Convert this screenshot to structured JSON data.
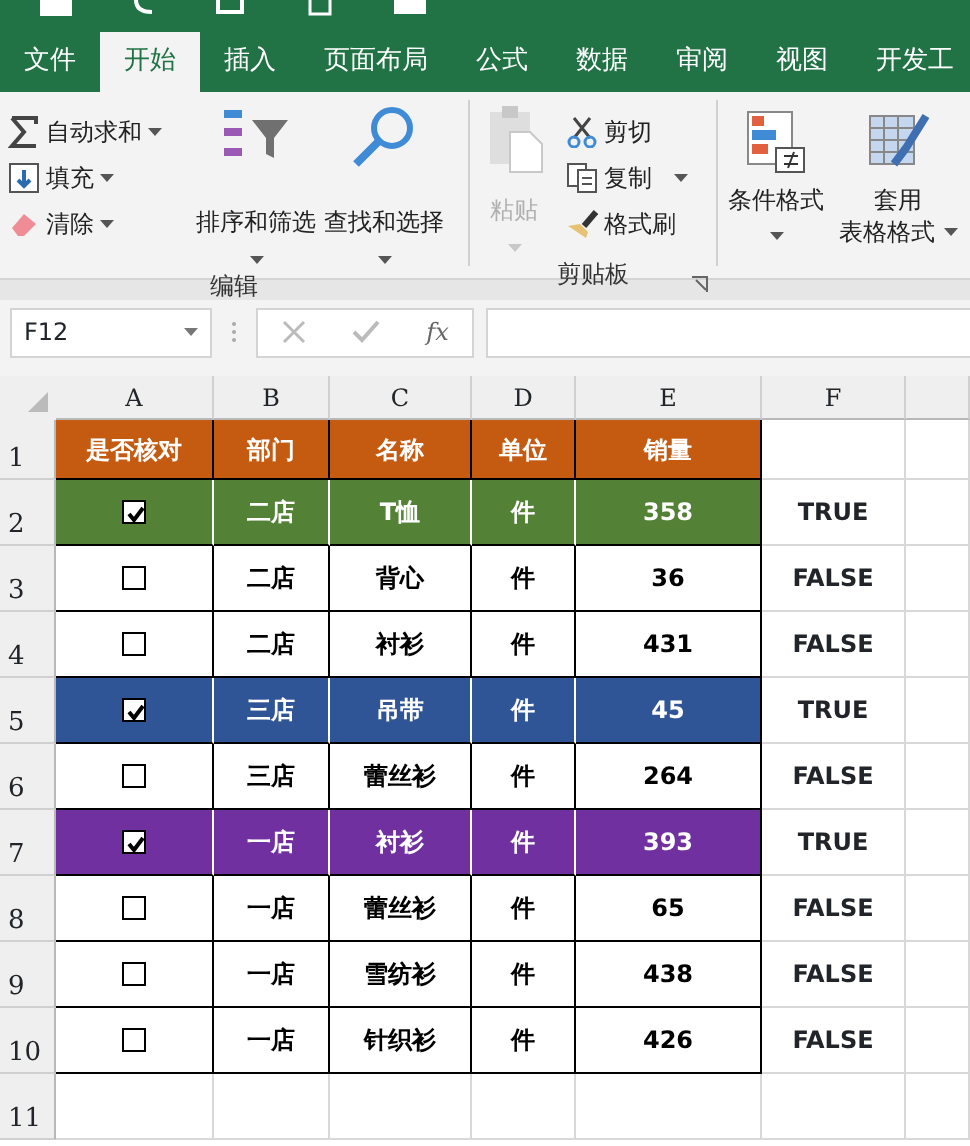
{
  "tabs": [
    {
      "label": "文件",
      "selected": false
    },
    {
      "label": "开始",
      "selected": true
    },
    {
      "label": "插入",
      "selected": false
    },
    {
      "label": "页面布局",
      "selected": false
    },
    {
      "label": "公式",
      "selected": false
    },
    {
      "label": "数据",
      "selected": false
    },
    {
      "label": "审阅",
      "selected": false
    },
    {
      "label": "视图",
      "selected": false
    },
    {
      "label": "开发工",
      "selected": false
    }
  ],
  "ribbon": {
    "editing": {
      "label": "编辑",
      "small_items": [
        {
          "label": "自动求和",
          "dropdown": true
        },
        {
          "label": "填充",
          "dropdown": true
        },
        {
          "label": "清除",
          "dropdown": true
        }
      ],
      "large_items": [
        {
          "label": "排序和筛选",
          "dropdown": true
        },
        {
          "label": "查找和选择",
          "dropdown": true
        }
      ]
    },
    "clipboard": {
      "label": "剪贴板",
      "paste": {
        "label": "粘贴",
        "disabled": true,
        "dropdown": true
      },
      "small_items": [
        {
          "label": "剪切",
          "dropdown": false
        },
        {
          "label": "复制",
          "dropdown": true
        },
        {
          "label": "格式刷",
          "dropdown": false
        }
      ]
    },
    "styles": {
      "items": [
        {
          "lines": [
            "条件格式"
          ],
          "dropdown": true
        },
        {
          "lines": [
            "套用",
            "表格格式"
          ],
          "dropdown": true
        }
      ]
    }
  },
  "formula_bar": {
    "name_box": "F12",
    "function_label": "fx"
  },
  "sheet": {
    "columns": [
      "A",
      "B",
      "C",
      "D",
      "E",
      "F"
    ],
    "row_numbers": [
      "1",
      "2",
      "3",
      "4",
      "5",
      "6",
      "7",
      "8",
      "9",
      "10",
      "11"
    ],
    "header": {
      "color": "#c55a11",
      "cells": [
        "是否核对",
        "部门",
        "名称",
        "单位",
        "销量"
      ]
    },
    "rows": [
      {
        "checked": true,
        "color": "#538135",
        "cells": [
          "",
          "二店",
          "T恤",
          "件",
          "358",
          "TRUE"
        ]
      },
      {
        "checked": false,
        "color": "#ffffff",
        "cells": [
          "",
          "二店",
          "背心",
          "件",
          "36",
          "FALSE"
        ]
      },
      {
        "checked": false,
        "color": "#ffffff",
        "cells": [
          "",
          "二店",
          "衬衫",
          "件",
          "431",
          "FALSE"
        ]
      },
      {
        "checked": true,
        "color": "#2f5597",
        "cells": [
          "",
          "三店",
          "吊带",
          "件",
          "45",
          "TRUE"
        ]
      },
      {
        "checked": false,
        "color": "#ffffff",
        "cells": [
          "",
          "三店",
          "蕾丝衫",
          "件",
          "264",
          "FALSE"
        ]
      },
      {
        "checked": true,
        "color": "#7030a0",
        "cells": [
          "",
          "一店",
          "衬衫",
          "件",
          "393",
          "TRUE"
        ]
      },
      {
        "checked": false,
        "color": "#ffffff",
        "cells": [
          "",
          "一店",
          "蕾丝衫",
          "件",
          "65",
          "FALSE"
        ]
      },
      {
        "checked": false,
        "color": "#ffffff",
        "cells": [
          "",
          "一店",
          "雪纺衫",
          "件",
          "438",
          "FALSE"
        ]
      },
      {
        "checked": false,
        "color": "#ffffff",
        "cells": [
          "",
          "一店",
          "针织衫",
          "件",
          "426",
          "FALSE"
        ]
      }
    ]
  }
}
